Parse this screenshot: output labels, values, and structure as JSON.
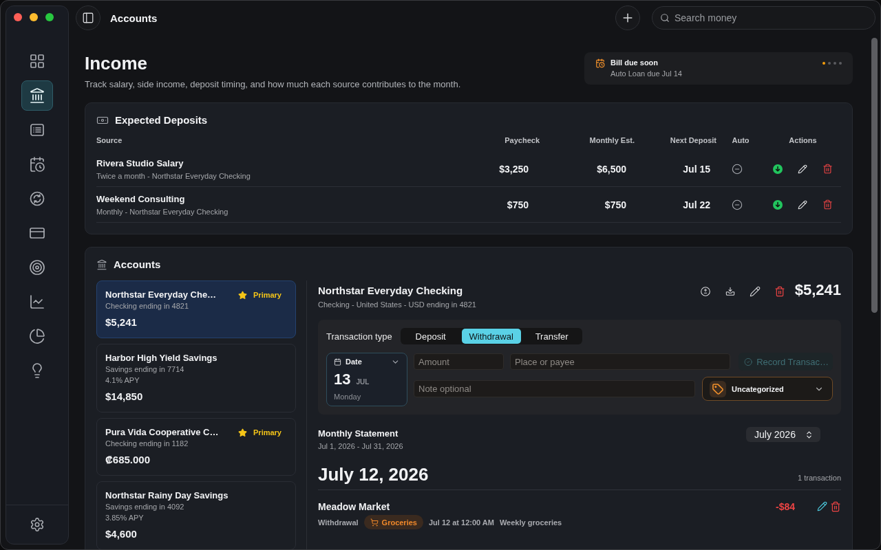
{
  "window": {
    "title": "Accounts"
  },
  "sidebar": {
    "items": [
      {
        "selected": false
      },
      {
        "selected": true
      },
      {
        "selected": false
      },
      {
        "selected": false
      },
      {
        "selected": false
      },
      {
        "selected": false
      },
      {
        "selected": false
      },
      {
        "selected": false
      },
      {
        "selected": false
      },
      {
        "selected": false
      }
    ]
  },
  "search": {
    "placeholder": "Search money"
  },
  "page": {
    "title": "Income",
    "subtitle": "Track salary, side income, deposit timing, and how much each source contributes to the month."
  },
  "notification": {
    "title": "Bill due soon",
    "text": "Auto Loan due Jul 14",
    "pages": [
      {
        "selected": true
      },
      {
        "selected": false
      },
      {
        "selected": false
      },
      {
        "selected": false
      }
    ]
  },
  "expected_deposits": {
    "title": "Expected Deposits",
    "columns": [
      "Source",
      "Paycheck",
      "Monthly Est.",
      "Next Deposit",
      "Auto",
      "Actions"
    ],
    "rows": [
      {
        "name": "Rivera Studio Salary",
        "detail": "Twice a month - Northstar Everyday Checking",
        "paycheck": "$3,250",
        "monthly": "$6,500",
        "next": "Jul 15",
        "auto": false
      },
      {
        "name": "Weekend Consulting",
        "detail": "Monthly - Northstar Everyday Checking",
        "paycheck": "$750",
        "monthly": "$750",
        "next": "Jul 22",
        "auto": false
      }
    ]
  },
  "accounts": {
    "title": "Accounts",
    "items": [
      {
        "name": "Northstar Everyday Che…",
        "detail": "Checking ending in 4821",
        "balance": "$5,241",
        "badge": "Primary",
        "selected": true
      },
      {
        "name": "Harbor High Yield Savings",
        "detail": "Savings ending in 7714",
        "rate": "4.1% APY",
        "balance": "$14,850",
        "selected": false
      },
      {
        "name": "Pura Vida Cooperative C…",
        "detail": "Checking ending in 1182",
        "balance": "₡685.000",
        "badge": "Primary",
        "selected": false
      },
      {
        "name": "Northstar Rainy Day Savings",
        "detail": "Savings ending in 4092",
        "rate": "3.85% APY",
        "balance": "$4,600",
        "selected": false
      }
    ],
    "detail": {
      "title": "Northstar Everyday Checking",
      "subtitle": "Checking - United States - USD ending in 4821",
      "balance": "$5,241",
      "form": {
        "type_label": "Transaction type",
        "types": [
          {
            "label": "Deposit",
            "selected": false
          },
          {
            "label": "Withdrawal",
            "selected": true
          },
          {
            "label": "Transfer",
            "selected": false
          }
        ],
        "date": {
          "label": "Date",
          "day": "13",
          "month": "JUL",
          "weekday": "Monday"
        },
        "amount": {
          "placeholder": "Amount"
        },
        "payee": {
          "placeholder": "Place or payee"
        },
        "record_button": {
          "label": "Record Transac…",
          "disabled": true
        },
        "note": {
          "placeholder": "Note optional"
        },
        "category": {
          "value": "Uncategorized"
        }
      },
      "statement": {
        "title": "Monthly Statement",
        "range": "Jul 1, 2026 - Jul 31, 2026",
        "period": "July 2026",
        "days": [
          {
            "date": "July 12, 2026",
            "count": "1 transaction",
            "transactions": [
              {
                "payee": "Meadow Market",
                "type": "Withdrawal",
                "category": "Groceries",
                "time": "Jul 12 at 12:00 AM",
                "note": "Weekly groceries",
                "amount": "-$84"
              }
            ]
          }
        ]
      }
    }
  }
}
